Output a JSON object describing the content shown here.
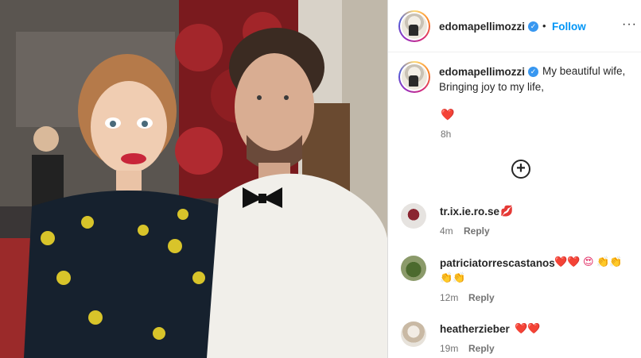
{
  "post": {
    "username": "edomapellimozzi",
    "follow_label": "Follow",
    "more_label": "···",
    "caption_lines": [
      "My beautiful wife,",
      "Bringing joy to my life,"
    ],
    "caption_emoji": "❤️",
    "time": "8h",
    "load_more_icon": "+"
  },
  "comments": [
    {
      "user": "tr.ix.ie.ro.se",
      "emoji": "💋",
      "time": "4m",
      "reply": "Reply"
    },
    {
      "user": "patriciatorrescastanos",
      "emoji": "❤️❤️ 😍 👏👏",
      "emoji2": "👏👏",
      "time": "12m",
      "reply": "Reply"
    },
    {
      "user": "heatherzieber",
      "emoji": "❤️❤️",
      "time": "19m",
      "reply": "Reply"
    }
  ],
  "colors": {
    "accent": "#0095f6",
    "verified": "#3897f0",
    "muted": "#737373"
  }
}
